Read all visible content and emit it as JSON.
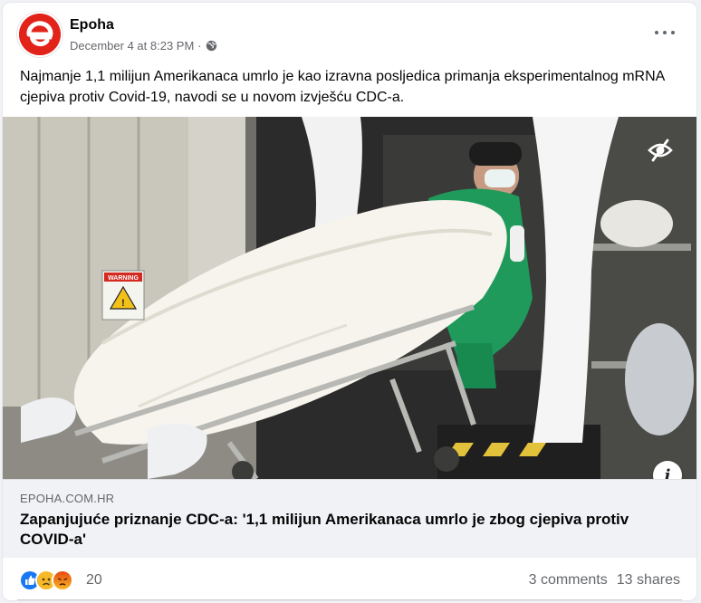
{
  "post": {
    "author": "Epoha",
    "timestamp": "December 4 at 8:23 PM",
    "separator": "·",
    "privacy_icon": "globe-icon",
    "text": "Najmanje 1,1 milijun Amerikanaca umrlo je kao izravna posljedica primanja eksperimentalnog mRNA cjepiva protiv Covid-19, navodi se u novom izvješću CDC-a."
  },
  "link_preview": {
    "domain": "EPOHA.COM.HR",
    "title": "Zapanjujuće priznanje CDC-a: '1,1 milijun Amerikanaca umrlo je zbog cjepiva protiv COVID-a'"
  },
  "photo": {
    "sign_text": "WARNING",
    "hide_icon": "eye-slash-icon",
    "info_icon": "info-icon",
    "info_glyph": "i"
  },
  "engagement": {
    "reaction_icons": [
      "like-icon",
      "sad-icon",
      "angry-icon"
    ],
    "reaction_count": "20",
    "comments": "3 comments",
    "shares": "13 shares"
  },
  "colors": {
    "brand": "#e2231a",
    "like": "#1877f2",
    "reaction_yellow": "#f7b928",
    "angry": "#e9710f"
  }
}
